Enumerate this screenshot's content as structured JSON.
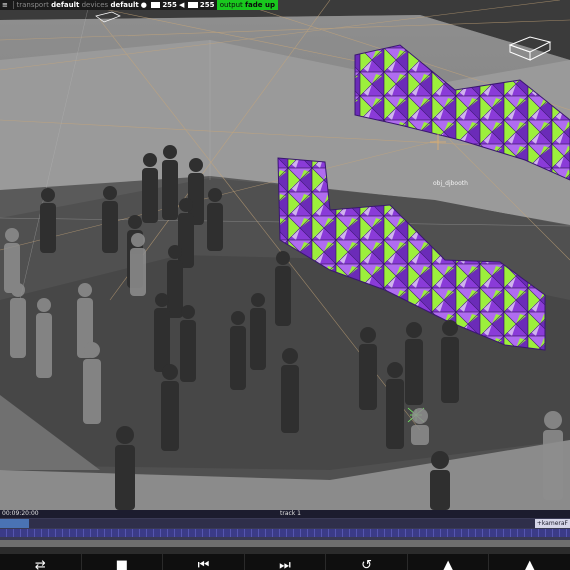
{
  "topbar": {
    "transport_label": "transport",
    "transport_value": "default",
    "devices_label": "devices",
    "devices_value": "default",
    "brightness_value": "255",
    "volume_value": "255",
    "output_label": "output",
    "output_value": "fade up"
  },
  "scene": {
    "object_label": "obj_djbooth"
  },
  "timeline": {
    "time": "00:09:20:00",
    "track_name": "track 1",
    "camera_tag": "+kameraF",
    "progress_fraction": 0.05
  },
  "transport": {
    "buttons": [
      {
        "name": "loop-button",
        "icon": "shuffle-icon",
        "glyph": "⇄"
      },
      {
        "name": "stop-button",
        "icon": "stop-icon",
        "glyph": "■"
      },
      {
        "name": "previous-button",
        "icon": "skip-back-icon",
        "glyph": "⏮"
      },
      {
        "name": "next-button",
        "icon": "skip-forward-icon",
        "glyph": "⏭"
      },
      {
        "name": "undo-button",
        "icon": "undo-icon",
        "glyph": "↺"
      },
      {
        "name": "up-button",
        "icon": "triangle-up-icon",
        "glyph": "▲"
      },
      {
        "name": "eject-button",
        "icon": "triangle-up-icon",
        "glyph": "▲"
      }
    ]
  },
  "colors": {
    "output_active": "#19c81e",
    "panel_purple": "#8a3bd8",
    "panel_green": "#9cf03c"
  }
}
